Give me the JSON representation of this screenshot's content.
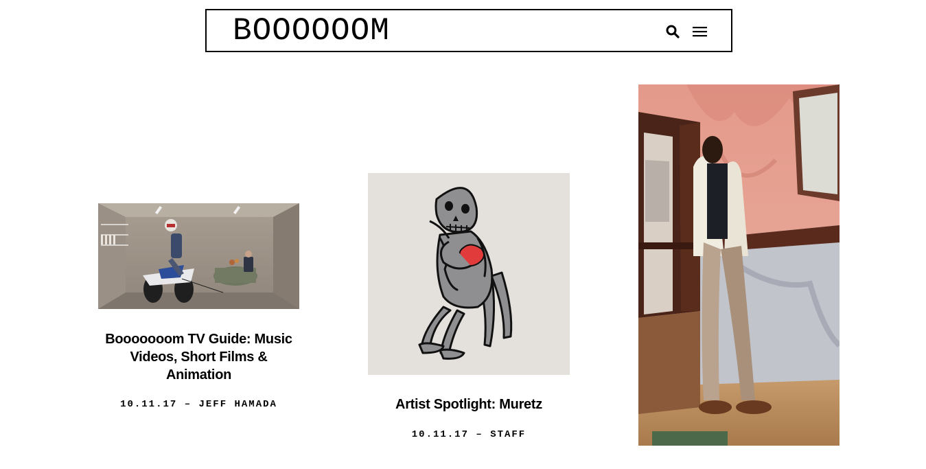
{
  "header": {
    "logo": "BOOOOOOM",
    "search_icon": "search-icon",
    "menu_icon": "hamburger-menu-icon"
  },
  "posts": [
    {
      "title": "Booooooom TV Guide: Music Videos, Short Films & Animation",
      "date": "10.11.17",
      "separator": "–",
      "author": "JEFF HAMADA"
    },
    {
      "title": "Artist Spotlight: Muretz",
      "date": "10.11.17",
      "separator": "–",
      "author": "STAFF"
    }
  ],
  "colors": {
    "text": "#000000",
    "background": "#ffffff",
    "bubble_red": "#e23b3b",
    "wall_pink": "#e9a18f"
  }
}
